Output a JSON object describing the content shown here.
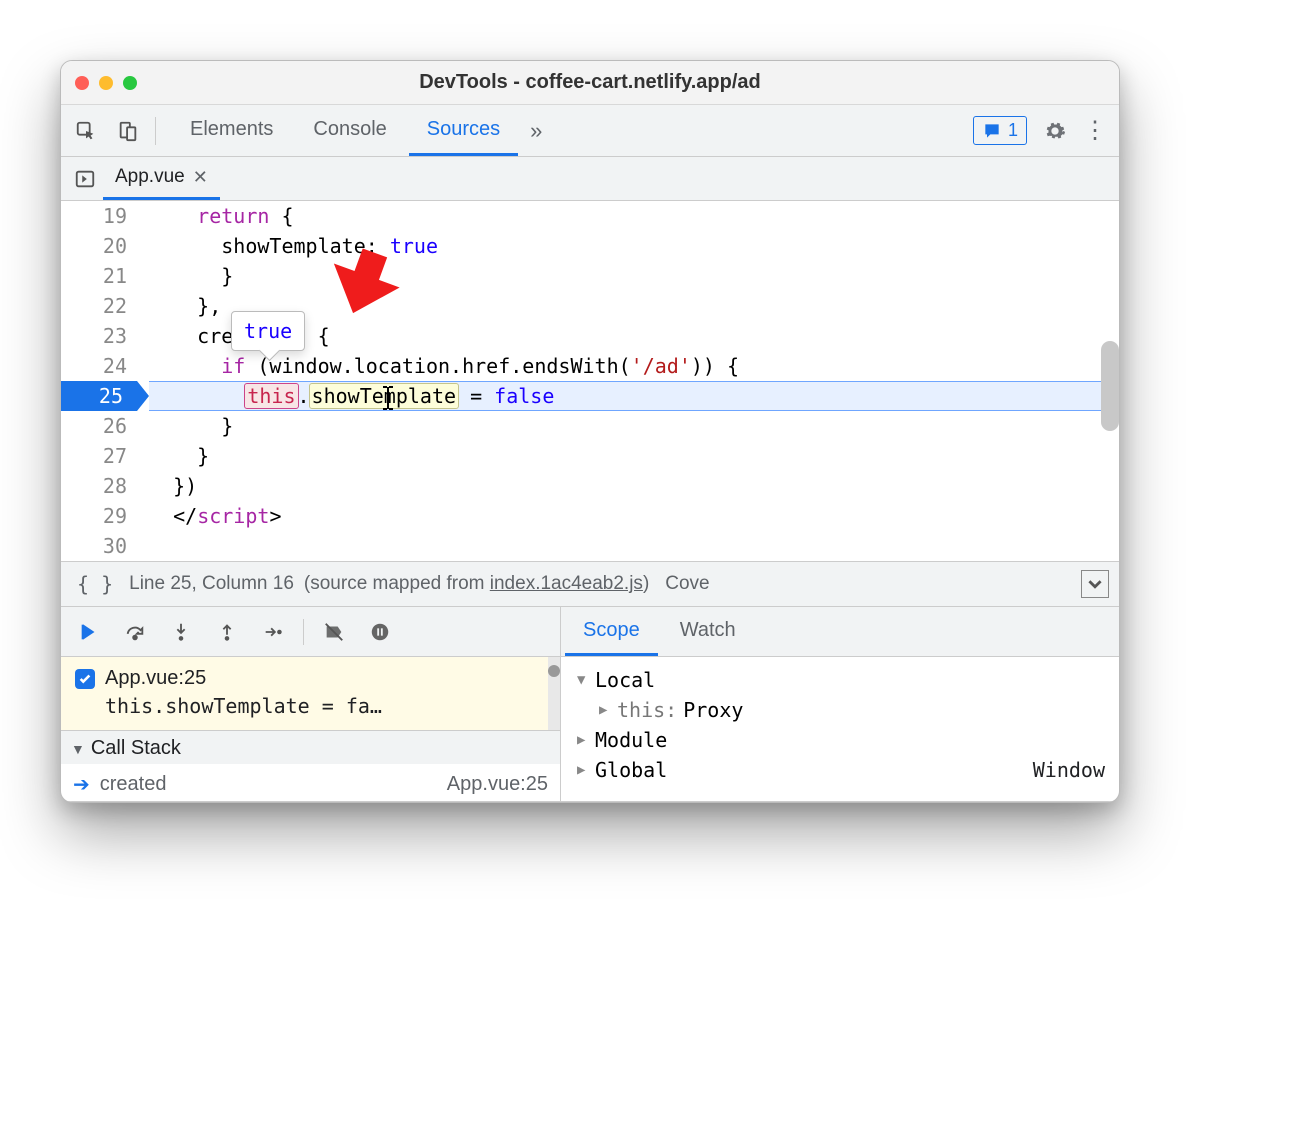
{
  "title": "DevTools - coffee-cart.netlify.app/ad",
  "toolbar": {
    "tabs": [
      "Elements",
      "Console",
      "Sources"
    ],
    "active_tab": 2,
    "issues_count": "1"
  },
  "file_tab": {
    "name": "App.vue"
  },
  "editor": {
    "first_line": 19,
    "breakpoint_line": 25,
    "tooltip_value": "true",
    "lines": {
      "l19_kw": "return",
      "l19_rest": " {",
      "l20_prop": "showTemplate:",
      "l20_val": "true",
      "l21": "      }",
      "l22": "    },",
      "l23_ident": "created()",
      "l23_rest": " {",
      "l24_kw": "if",
      "l24_mid": " (window.location.href.endsWith(",
      "l24_str": "'/ad'",
      "l24_end": ")) {",
      "l25_this": "this",
      "l25_dot": ".",
      "l25_show": "showTemplate",
      "l25_rest": " = ",
      "l25_val": "false",
      "l26": "      }",
      "l27": "    }",
      "l28": "  })",
      "l29_open": "</",
      "l29_tag": "script",
      "l29_close": ">"
    }
  },
  "status": {
    "pretty": "{ }",
    "pos": "Line 25, Column 16",
    "mapped_prefix": "(source mapped from ",
    "mapped_file": "index.1ac4eab2.js",
    "mapped_suffix": ")",
    "coverage_label": "Cove"
  },
  "debugger": {
    "right_tabs": [
      "Scope",
      "Watch"
    ],
    "right_active": 0,
    "breakpoint": {
      "file": "App.vue:25",
      "code": "this.showTemplate = fa…"
    },
    "callstack_header": "Call Stack",
    "callstack": {
      "fn": "created",
      "loc": "App.vue:25"
    },
    "scope": {
      "local_label": "Local",
      "this_key": "this",
      "this_val": "Proxy",
      "module_label": "Module",
      "global_label": "Global",
      "global_val": "Window"
    }
  }
}
